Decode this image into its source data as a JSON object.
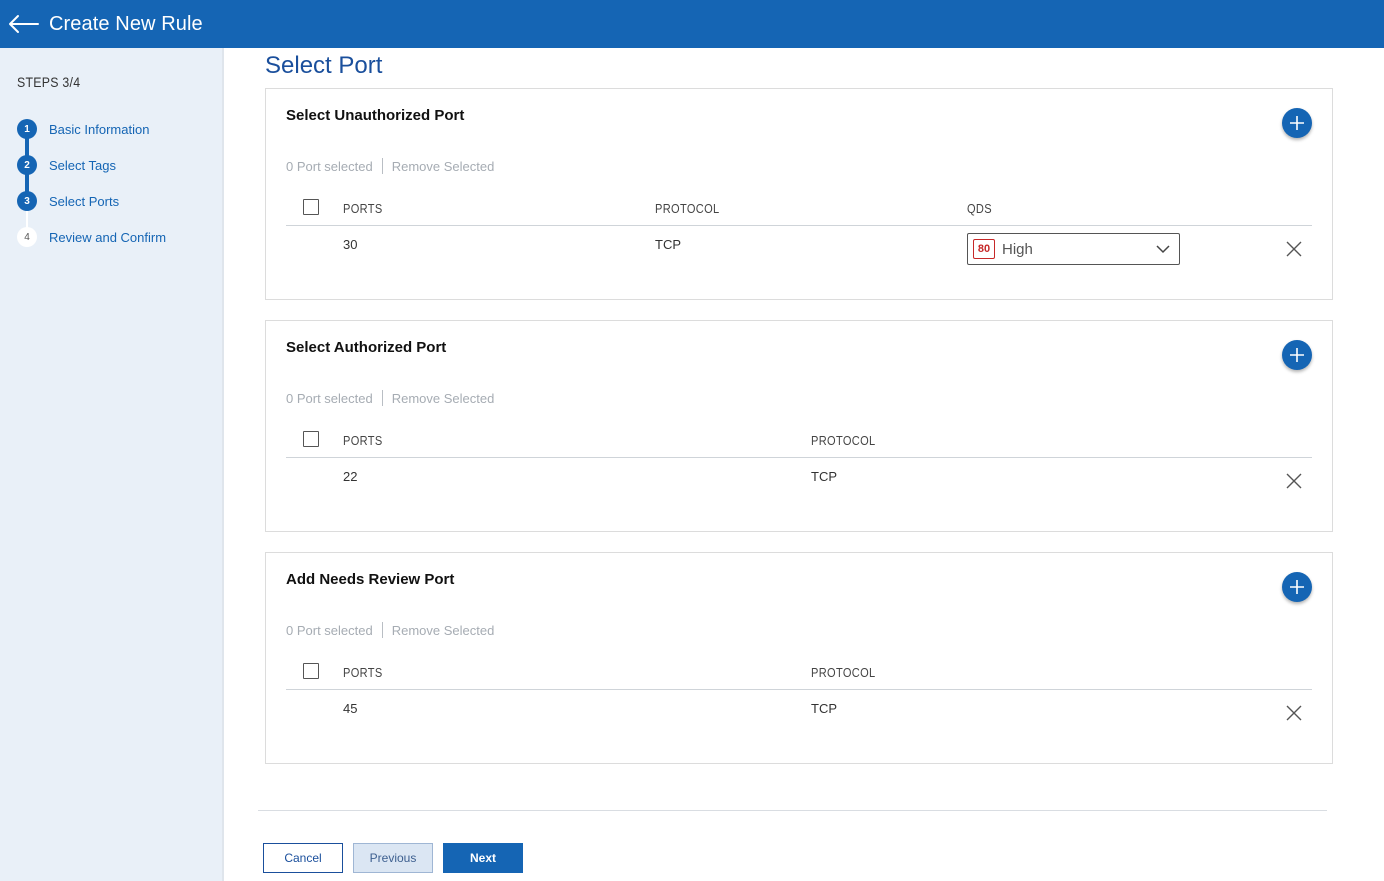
{
  "header": {
    "title": "Create New Rule",
    "back_icon": "arrow-left-icon"
  },
  "sidebar": {
    "steps_label": "STEPS 3/4",
    "steps": [
      {
        "number": "1",
        "label": "Basic Information",
        "state": "done"
      },
      {
        "number": "2",
        "label": "Select Tags",
        "state": "done"
      },
      {
        "number": "3",
        "label": "Select Ports",
        "state": "current"
      },
      {
        "number": "4",
        "label": "Review and Confirm",
        "state": "todo"
      }
    ]
  },
  "page": {
    "title": "Select Port"
  },
  "sections": {
    "unauthorized": {
      "title": "Select Unauthorized Port",
      "selected_text": "0 Port selected",
      "remove_text": "Remove Selected",
      "columns": [
        "PORTS",
        "PROTOCOL",
        "QDS"
      ],
      "rows": [
        {
          "port": "30",
          "protocol": "TCP",
          "qds_score": "80",
          "qds_label": "High"
        }
      ]
    },
    "authorized": {
      "title": "Select Authorized Port",
      "selected_text": "0 Port selected",
      "remove_text": "Remove Selected",
      "columns": [
        "PORTS",
        "PROTOCOL"
      ],
      "rows": [
        {
          "port": "22",
          "protocol": "TCP"
        }
      ]
    },
    "needs_review": {
      "title": "Add Needs Review Port",
      "selected_text": "0 Port selected",
      "remove_text": "Remove Selected",
      "columns": [
        "PORTS",
        "PROTOCOL"
      ],
      "rows": [
        {
          "port": "45",
          "protocol": "TCP"
        }
      ]
    }
  },
  "footer": {
    "cancel": "Cancel",
    "previous": "Previous",
    "next": "Next"
  },
  "colors": {
    "primary": "#1565b4",
    "sidebar_bg": "#e9f0f8",
    "qds_high": "#c62828"
  }
}
